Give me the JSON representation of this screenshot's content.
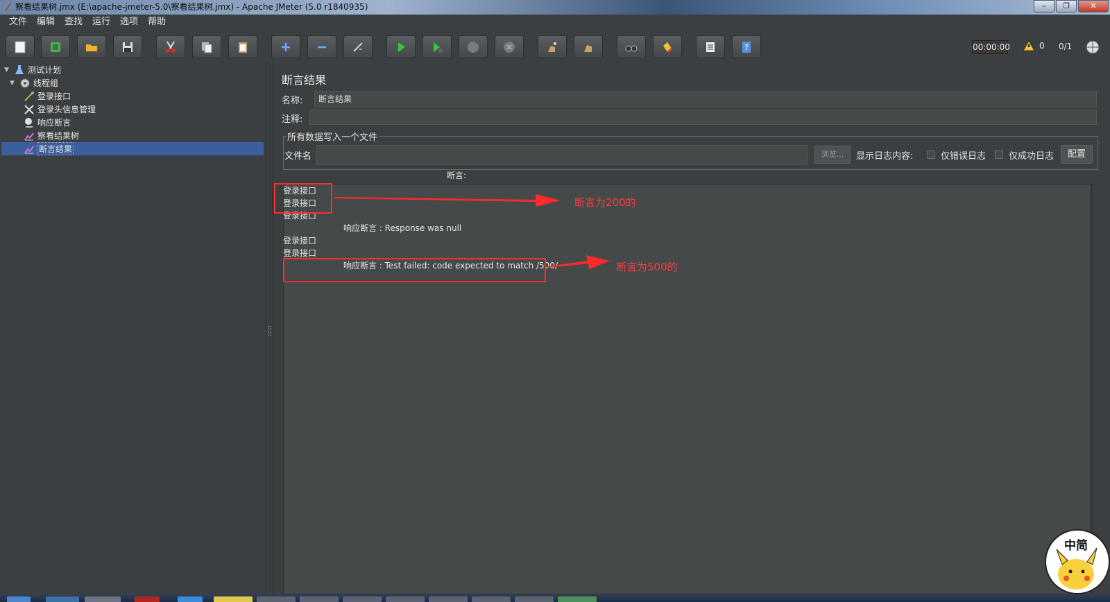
{
  "window": {
    "title": "察看结果树.jmx (E:\\apache-jmeter-5.0\\察看结果树.jmx) - Apache JMeter (5.0 r1840935)",
    "minimize_label": "–",
    "maximize_label": "❐",
    "close_label": "✕"
  },
  "menu": [
    "文件",
    "编辑",
    "查找",
    "运行",
    "选项",
    "帮助"
  ],
  "toolbar": {
    "timer": "00:00:00",
    "warning_count": "0",
    "threads": "0/1"
  },
  "tree": {
    "items": [
      {
        "label": "测试计划",
        "icon": "flask-icon"
      },
      {
        "label": "线程组",
        "icon": "gear-icon"
      },
      {
        "label": "登录接口",
        "icon": "pipette-icon"
      },
      {
        "label": "登录头信息管理",
        "icon": "tools-icon"
      },
      {
        "label": "响应断言",
        "icon": "assertion-icon"
      },
      {
        "label": "察看结果树",
        "icon": "chart-icon"
      },
      {
        "label": "断言结果",
        "icon": "chart-icon"
      }
    ]
  },
  "panel": {
    "title": "断言结果",
    "name_label": "名称:",
    "name_value": "断言结果",
    "comment_label": "注释:",
    "comment_value": "",
    "file_group_title": "所有数据写入一个文件",
    "filename_label": "文件名",
    "filename_value": "",
    "browse_label": "浏览...",
    "log_label": "显示日志内容:",
    "errors_only_label": "仅错误日志",
    "success_only_label": "仅成功日志",
    "config_label": "配置",
    "assert_header": "断言:"
  },
  "results": [
    "登录接口",
    "登录接口",
    "登录接口",
    "响应断言 : Response was null",
    "登录接口",
    "登录接口",
    "响应断言 : Test failed: code expected to match /500/"
  ],
  "annotations": {
    "first": "断言为200的",
    "second": "断言为500的",
    "color": "#ff2a2a"
  },
  "mascot_text": "中简"
}
